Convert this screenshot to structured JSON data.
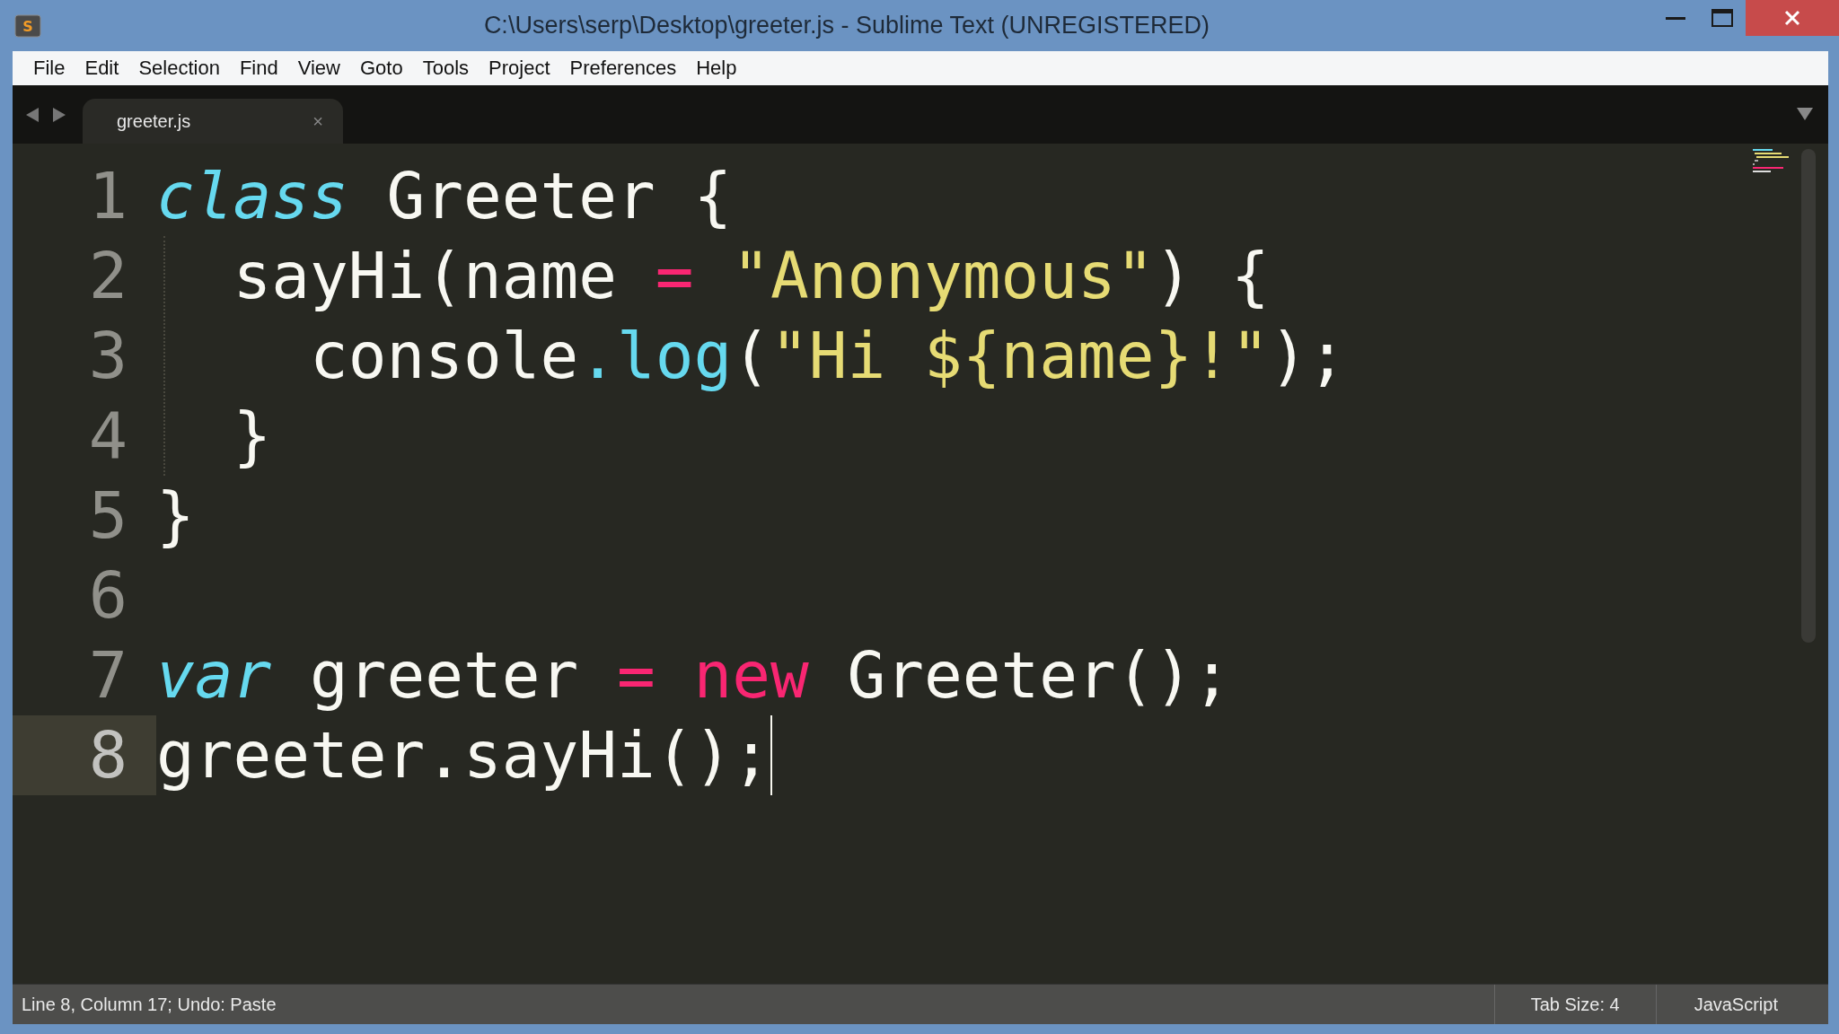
{
  "window": {
    "title": "C:\\Users\\serp\\Desktop\\greeter.js - Sublime Text (UNREGISTERED)",
    "icon_letter": "S"
  },
  "menu": [
    {
      "label": "File"
    },
    {
      "label": "Edit"
    },
    {
      "label": "Selection"
    },
    {
      "label": "Find"
    },
    {
      "label": "View"
    },
    {
      "label": "Goto"
    },
    {
      "label": "Tools"
    },
    {
      "label": "Project"
    },
    {
      "label": "Preferences"
    },
    {
      "label": "Help"
    }
  ],
  "tabs": [
    {
      "label": "greeter.js",
      "selected": true,
      "close": "×"
    }
  ],
  "editor": {
    "lines": [
      {
        "number": "1",
        "current": false,
        "tokens": [
          {
            "kind": "storage",
            "text": "class"
          },
          {
            "kind": "plain",
            "text": " Greeter {"
          }
        ]
      },
      {
        "number": "2",
        "current": false,
        "tokens": [
          {
            "kind": "plain",
            "text": "  sayHi(name "
          },
          {
            "kind": "operator",
            "text": "= "
          },
          {
            "kind": "string",
            "text": "\"Anonymous\""
          },
          {
            "kind": "plain",
            "text": ") {"
          }
        ]
      },
      {
        "number": "3",
        "current": false,
        "tokens": [
          {
            "kind": "plain",
            "text": "    console"
          },
          {
            "kind": "function",
            "text": ".log"
          },
          {
            "kind": "plain",
            "text": "("
          },
          {
            "kind": "string",
            "text": "\"Hi ${name}!\""
          },
          {
            "kind": "plain",
            "text": ");"
          }
        ]
      },
      {
        "number": "4",
        "current": false,
        "tokens": [
          {
            "kind": "plain",
            "text": "  }"
          }
        ]
      },
      {
        "number": "5",
        "current": false,
        "tokens": [
          {
            "kind": "plain",
            "text": "}"
          }
        ]
      },
      {
        "number": "6",
        "current": false
      },
      {
        "number": "7",
        "current": false,
        "tokens": [
          {
            "kind": "storage",
            "text": "var"
          },
          {
            "kind": "plain",
            "text": " greeter "
          },
          {
            "kind": "operator",
            "text": "= new"
          },
          {
            "kind": "plain",
            "text": " Greeter();"
          }
        ]
      },
      {
        "number": "8",
        "current": true,
        "tokens": [
          {
            "kind": "plain",
            "text": "greeter.sayHi();"
          }
        ]
      }
    ]
  },
  "status_bar": {
    "position": "Line 8, Column 17; Undo: Paste",
    "tab_size": "Tab Size: 4",
    "syntax": "JavaScript"
  }
}
